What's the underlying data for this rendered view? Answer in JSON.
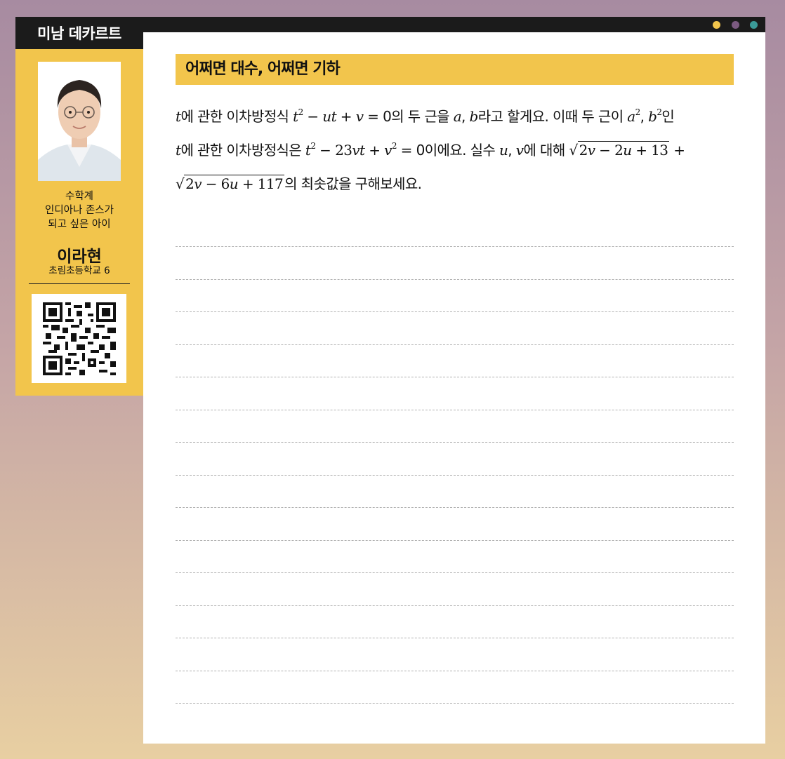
{
  "sidebar": {
    "column_title": "미남 데카르트",
    "caption_lines": [
      "수학계",
      "인디아나 존스가",
      "되고 싶은 아이"
    ],
    "student_name": "이라현",
    "school": "초림초등학교 6"
  },
  "window": {
    "dot_colors": [
      "#f2c54c",
      "#7b5a80",
      "#3b9a98"
    ]
  },
  "article": {
    "title": "어쩌면 대수, 어쩌면 기하",
    "problem": {
      "l1": {
        "a": "t",
        "b": "에 관한 이차방정식 ",
        "c": "t",
        "c_sup": "2",
        "d": " − ",
        "e": "ut",
        "f": " + ",
        "g": "v",
        "h": " = 0의 두 근을 ",
        "i": "a",
        "j": ", ",
        "k": "b",
        "l": "라고 할게요. 이때 두 근이 ",
        "m": "a",
        "m_sup": "2",
        "n": ", ",
        "o": "b",
        "o_sup": "2",
        "p": "인"
      },
      "l2": {
        "a": "t",
        "b": "에 관한 이차방정식은 ",
        "c": "t",
        "c_sup": "2",
        "d": " − 23",
        "e": "vt",
        "f": " + ",
        "g": "v",
        "g_sup": "2",
        "h": " = 0이에요. 실수 ",
        "i": "u",
        "j": ", ",
        "k": "v",
        "l": "에 대해 ",
        "sqrt_a": "2",
        "sqrt_b": "v",
        "sqrt_c": " − 2",
        "sqrt_d": "u",
        "sqrt_e": " + 13",
        "plus": " +"
      },
      "l3": {
        "sqrt_a": "2",
        "sqrt_b": "v",
        "sqrt_c": " − 6",
        "sqrt_d": "u",
        "sqrt_e": " + 117",
        "tail": "의 최솟값을 구해보세요."
      }
    },
    "answer_line_count": 15
  }
}
